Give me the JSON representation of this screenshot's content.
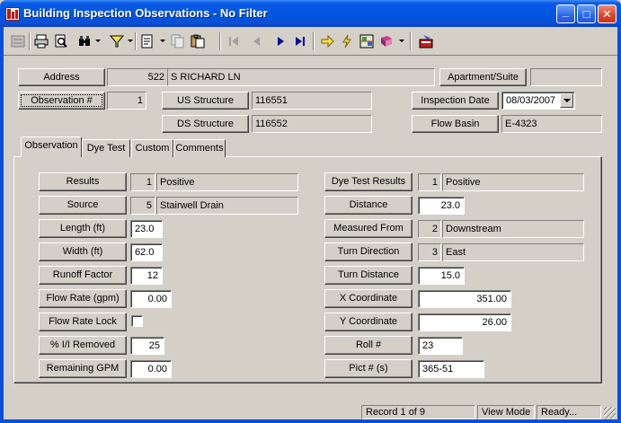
{
  "window": {
    "title": "Building Inspection Observations - No Filter",
    "minimize_glyph": "_",
    "maximize_glyph": "□",
    "close_glyph": "✕"
  },
  "toolbar": {
    "icons": [
      "form-icon",
      "print-icon",
      "print-preview-icon",
      "find-icon",
      "filter-icon",
      "report-icon",
      "copy-icon",
      "paste-icon",
      "first-record-icon",
      "previous-record-icon",
      "next-record-icon",
      "last-record-icon",
      "goto-icon",
      "lightning-icon",
      "map-icon",
      "book-icon",
      "exit-icon"
    ]
  },
  "header": {
    "address_label": "Address",
    "address_number": "522",
    "address_street": "S RICHARD LN",
    "apartment_label": "Apartment/Suite",
    "apartment_value": "",
    "observation_label": "Observation #",
    "observation_value": "1",
    "us_structure_label": "US Structure",
    "us_structure_value": "116551",
    "ds_structure_label": "DS Structure",
    "ds_structure_value": "116552",
    "inspection_date_label": "Inspection Date",
    "inspection_date_value": "08/03/2007",
    "flow_basin_label": "Flow Basin",
    "flow_basin_value": "E-4323"
  },
  "tabs": [
    {
      "label": "Observation",
      "active": true
    },
    {
      "label": "Dye Test",
      "active": false
    },
    {
      "label": "Custom",
      "active": false
    },
    {
      "label": "Comments",
      "active": false
    }
  ],
  "observation": {
    "left": {
      "results_label": "Results",
      "results_code": "1",
      "results_text": "Positive",
      "source_label": "Source",
      "source_code": "5",
      "source_text": "Stairwell Drain",
      "length_label": "Length (ft)",
      "length_value": "23.0",
      "width_label": "Width (ft)",
      "width_value": "62.0",
      "runoff_label": "Runoff Factor",
      "runoff_value": "12",
      "flow_rate_label": "Flow Rate (gpm)",
      "flow_rate_value": "0.00",
      "flow_rate_lock_label": "Flow Rate Lock",
      "flow_rate_lock_checked": false,
      "ii_removed_label": "% I/I Removed",
      "ii_removed_value": "25",
      "remaining_gpm_label": "Remaining GPM",
      "remaining_gpm_value": "0.00"
    },
    "right": {
      "dye_results_label": "Dye Test Results",
      "dye_results_code": "1",
      "dye_results_text": "Positive",
      "distance_label": "Distance",
      "distance_value": "23.0",
      "measured_from_label": "Measured From",
      "measured_from_code": "2",
      "measured_from_text": "Downstream",
      "turn_direction_label": "Turn Direction",
      "turn_direction_code": "3",
      "turn_direction_text": "East",
      "turn_distance_label": "Turn Distance",
      "turn_distance_value": "15.0",
      "x_coord_label": "X Coordinate",
      "x_coord_value": "351.00",
      "y_coord_label": "Y Coordinate",
      "y_coord_value": "26.00",
      "roll_label": "Roll #",
      "roll_value": "23",
      "pict_label": "Pict # (s)",
      "pict_value": "365-51"
    }
  },
  "status": {
    "record": "Record 1 of 9",
    "mode": "View Mode",
    "state": "Ready..."
  },
  "colors": {
    "titlebar": "#0a4fd6",
    "face": "#d4d0c8",
    "nav_arrow": "#0000a0"
  }
}
